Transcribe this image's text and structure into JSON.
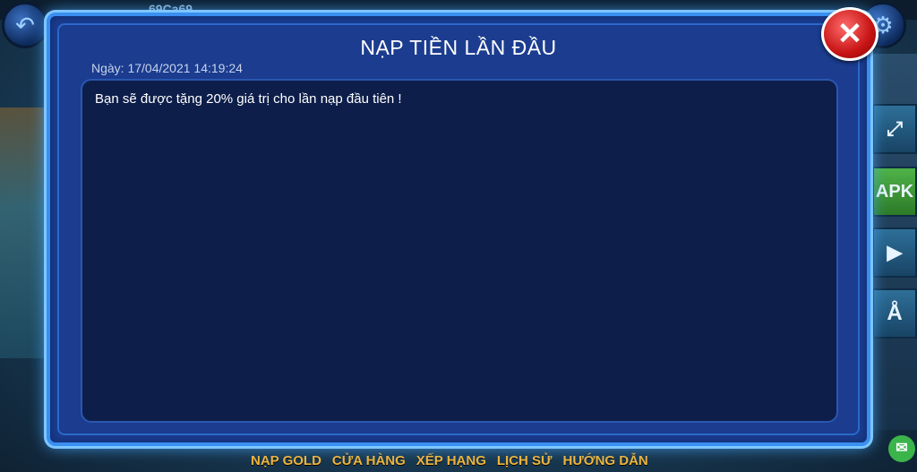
{
  "header": {
    "username": "69Ca69",
    "back_icon": "back-arrow-icon",
    "settings_icon": "gear-icon"
  },
  "side_buttons": {
    "fullscreen_icon": "fullscreen-icon",
    "apk_label": "APK",
    "play_icon": "google-play-icon",
    "appstore_icon": "app-store-icon"
  },
  "bottom_nav": {
    "items": [
      "NẠP GOLD",
      "CỬA HÀNG",
      "XẾP HẠNG",
      "LỊCH SỬ",
      "HƯỚNG DẪN"
    ]
  },
  "dialog": {
    "title": "NẠP TIỀN LẦN ĐẦU",
    "date": "Ngày: 17/04/2021 14:19:24",
    "message": "Bạn sẽ được tặng 20% giá trị cho lần nạp đầu tiên !",
    "close_icon": "close-icon"
  },
  "colors": {
    "dialog_bg": "#1b3c8f",
    "dialog_border": "#3a8ff0",
    "content_bg": "#0d1e4a",
    "close_red": "#c71414",
    "nav_gold": "#f2b53a"
  }
}
